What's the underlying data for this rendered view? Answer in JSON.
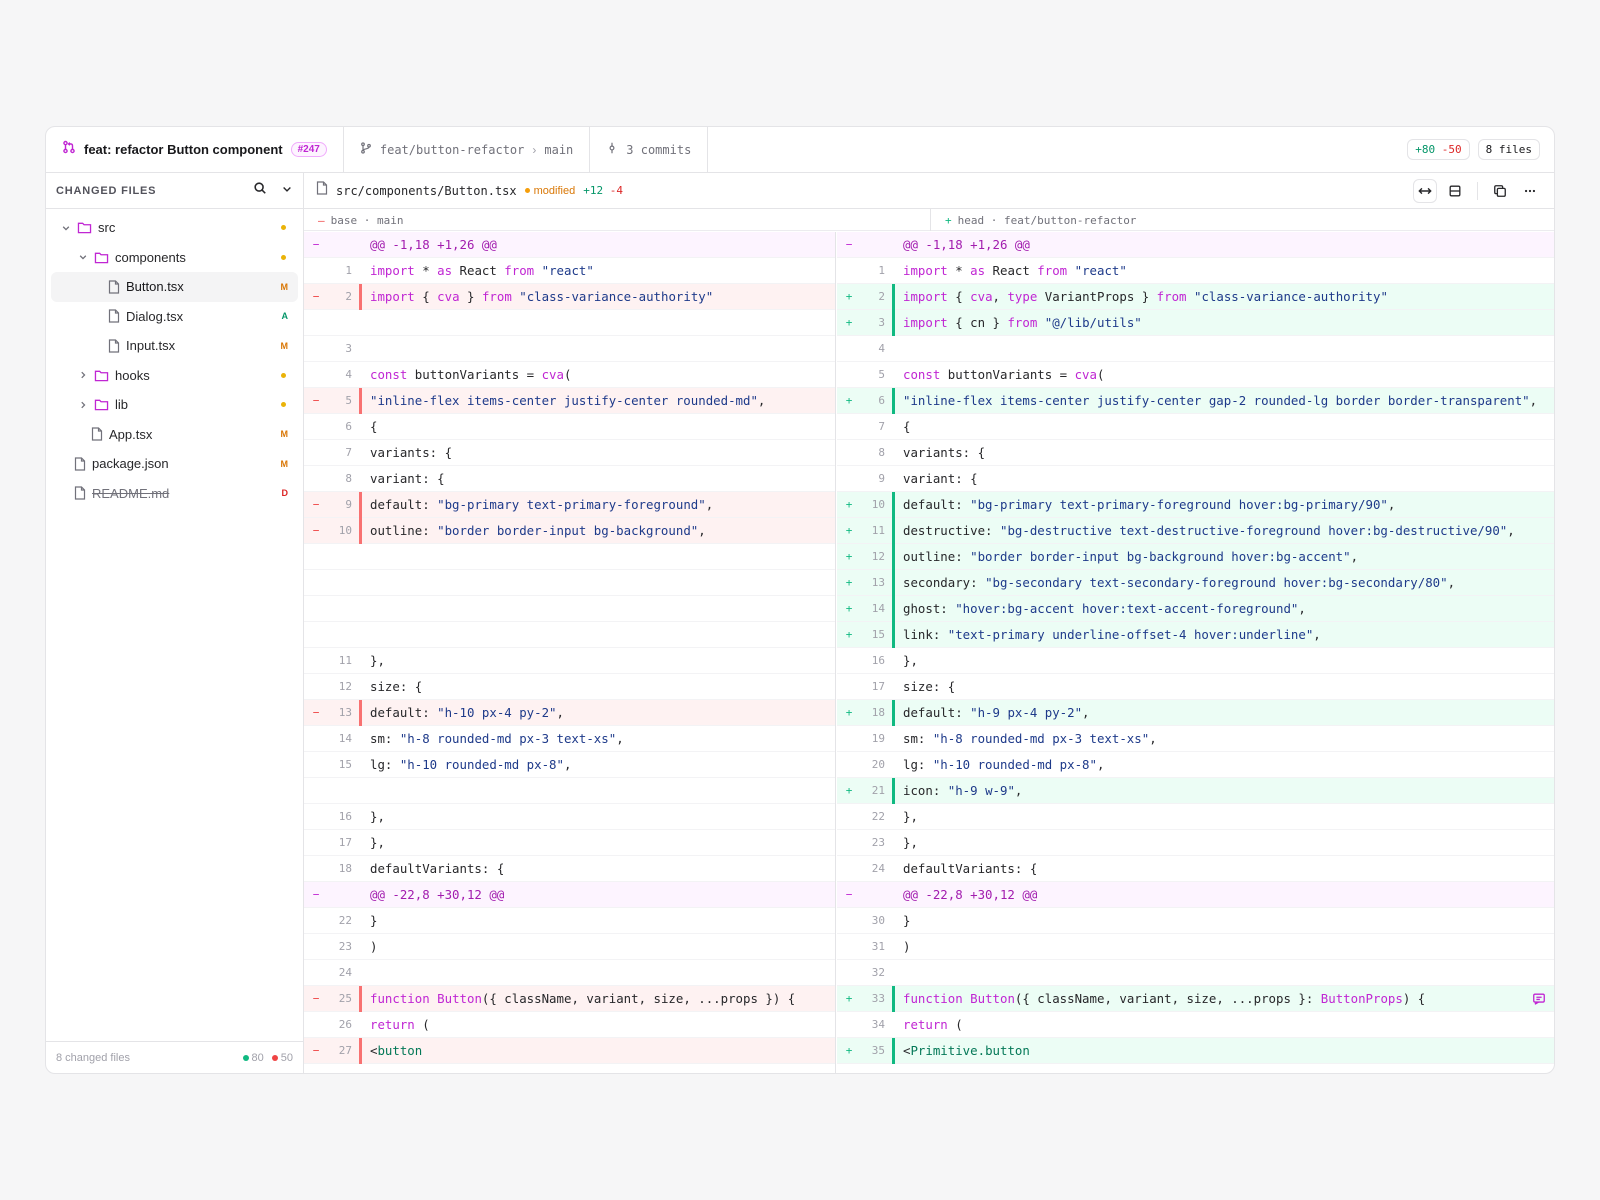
{
  "header": {
    "pr_title": "feat: refactor Button component",
    "pr_number": "#247",
    "source_branch": "feat/button-refactor",
    "target_branch": "main",
    "commits": "3 commits",
    "additions": "+80",
    "deletions": "-50",
    "files": "8 files"
  },
  "sidebar": {
    "title": "CHANGED FILES",
    "footer_label": "8 changed files",
    "footer_additions": "80",
    "footer_deletions": "50",
    "tree": [
      {
        "name": "src",
        "kind": "folder",
        "depth": 0,
        "open": true,
        "badge": "dot"
      },
      {
        "name": "components",
        "kind": "folder",
        "depth": 1,
        "open": true,
        "badge": "dot"
      },
      {
        "name": "Button.tsx",
        "kind": "file",
        "depth": 2,
        "badge": "M",
        "active": true
      },
      {
        "name": "Dialog.tsx",
        "kind": "file",
        "depth": 2,
        "badge": "A"
      },
      {
        "name": "Input.tsx",
        "kind": "file",
        "depth": 2,
        "badge": "M"
      },
      {
        "name": "hooks",
        "kind": "folder",
        "depth": 1,
        "open": false,
        "badge": "dot"
      },
      {
        "name": "lib",
        "kind": "folder",
        "depth": 1,
        "open": false,
        "badge": "dot"
      },
      {
        "name": "App.tsx",
        "kind": "file",
        "depth": 1,
        "badge": "M"
      },
      {
        "name": "package.json",
        "kind": "file",
        "depth": 0,
        "badge": "M"
      },
      {
        "name": "README.md",
        "kind": "file",
        "depth": 0,
        "badge": "D",
        "deleted": true
      }
    ]
  },
  "file": {
    "path": "src/components/Button.tsx",
    "status": "modified",
    "additions": "+12",
    "deletions": "-4"
  },
  "subheader": {
    "left_label": "base · main",
    "right_label": "head · feat/button-refactor"
  },
  "diff": {
    "left": [
      {
        "t": "hunk",
        "n": "",
        "c": "@@ -1,18 +1,26 @@"
      },
      {
        "t": "ctx",
        "n": "1",
        "c": "import * as React from \"react\""
      },
      {
        "t": "del",
        "n": "2",
        "c": "import { cva } from \"class-variance-authority\""
      },
      {
        "t": "empty",
        "n": "",
        "c": ""
      },
      {
        "t": "ctx",
        "n": "3",
        "c": ""
      },
      {
        "t": "ctx",
        "n": "4",
        "c": "const buttonVariants = cva("
      },
      {
        "t": "del",
        "n": "5",
        "c": "\"inline-flex items-center justify-center rounded-md\","
      },
      {
        "t": "ctx",
        "n": "6",
        "c": "{"
      },
      {
        "t": "ctx",
        "n": "7",
        "c": "variants: {"
      },
      {
        "t": "ctx",
        "n": "8",
        "c": "variant: {"
      },
      {
        "t": "del",
        "n": "9",
        "c": "default: \"bg-primary text-primary-foreground\","
      },
      {
        "t": "del",
        "n": "10",
        "c": "outline: \"border border-input bg-background\","
      },
      {
        "t": "empty",
        "n": "",
        "c": ""
      },
      {
        "t": "empty",
        "n": "",
        "c": ""
      },
      {
        "t": "empty",
        "n": "",
        "c": ""
      },
      {
        "t": "empty",
        "n": "",
        "c": ""
      },
      {
        "t": "ctx",
        "n": "11",
        "c": "},"
      },
      {
        "t": "ctx",
        "n": "12",
        "c": "size: {"
      },
      {
        "t": "del",
        "n": "13",
        "c": "default: \"h-10 px-4 py-2\","
      },
      {
        "t": "ctx",
        "n": "14",
        "c": "sm: \"h-8 rounded-md px-3 text-xs\","
      },
      {
        "t": "ctx",
        "n": "15",
        "c": "lg: \"h-10 rounded-md px-8\","
      },
      {
        "t": "empty",
        "n": "",
        "c": ""
      },
      {
        "t": "ctx",
        "n": "16",
        "c": "},"
      },
      {
        "t": "ctx",
        "n": "17",
        "c": "},"
      },
      {
        "t": "ctx",
        "n": "18",
        "c": "defaultVariants: {"
      },
      {
        "t": "hunk",
        "n": "",
        "c": "@@ -22,8 +30,12 @@"
      },
      {
        "t": "ctx",
        "n": "22",
        "c": "}"
      },
      {
        "t": "ctx",
        "n": "23",
        "c": ")"
      },
      {
        "t": "ctx",
        "n": "24",
        "c": ""
      },
      {
        "t": "del",
        "n": "25",
        "c": "function Button({ className, variant, size, ...props }) {"
      },
      {
        "t": "ctx",
        "n": "26",
        "c": "return ("
      },
      {
        "t": "del",
        "n": "27",
        "c": "<button"
      }
    ],
    "right": [
      {
        "t": "hunk",
        "n": "",
        "c": "@@ -1,18 +1,26 @@"
      },
      {
        "t": "ctx",
        "n": "1",
        "c": "import * as React from \"react\""
      },
      {
        "t": "add",
        "n": "2",
        "c": "import { cva, type VariantProps } from \"class-variance-authority\""
      },
      {
        "t": "add",
        "n": "3",
        "c": "import { cn } from \"@/lib/utils\""
      },
      {
        "t": "ctx",
        "n": "4",
        "c": ""
      },
      {
        "t": "ctx",
        "n": "5",
        "c": "const buttonVariants = cva("
      },
      {
        "t": "add",
        "n": "6",
        "c": "\"inline-flex items-center justify-center gap-2 rounded-lg border border-transparent\","
      },
      {
        "t": "ctx",
        "n": "7",
        "c": "{"
      },
      {
        "t": "ctx",
        "n": "8",
        "c": "variants: {"
      },
      {
        "t": "ctx",
        "n": "9",
        "c": "variant: {"
      },
      {
        "t": "add",
        "n": "10",
        "c": "default: \"bg-primary text-primary-foreground hover:bg-primary/90\","
      },
      {
        "t": "add",
        "n": "11",
        "c": "destructive: \"bg-destructive text-destructive-foreground hover:bg-destructive/90\","
      },
      {
        "t": "add",
        "n": "12",
        "c": "outline: \"border border-input bg-background hover:bg-accent\","
      },
      {
        "t": "add",
        "n": "13",
        "c": "secondary: \"bg-secondary text-secondary-foreground hover:bg-secondary/80\","
      },
      {
        "t": "add",
        "n": "14",
        "c": "ghost: \"hover:bg-accent hover:text-accent-foreground\","
      },
      {
        "t": "add",
        "n": "15",
        "c": "link: \"text-primary underline-offset-4 hover:underline\","
      },
      {
        "t": "ctx",
        "n": "16",
        "c": "},"
      },
      {
        "t": "ctx",
        "n": "17",
        "c": "size: {"
      },
      {
        "t": "add",
        "n": "18",
        "c": "default: \"h-9 px-4 py-2\","
      },
      {
        "t": "ctx",
        "n": "19",
        "c": "sm: \"h-8 rounded-md px-3 text-xs\","
      },
      {
        "t": "ctx",
        "n": "20",
        "c": "lg: \"h-10 rounded-md px-8\","
      },
      {
        "t": "add",
        "n": "21",
        "c": "icon: \"h-9 w-9\","
      },
      {
        "t": "ctx",
        "n": "22",
        "c": "},"
      },
      {
        "t": "ctx",
        "n": "23",
        "c": "},"
      },
      {
        "t": "ctx",
        "n": "24",
        "c": "defaultVariants: {"
      },
      {
        "t": "hunk",
        "n": "",
        "c": "@@ -22,8 +30,12 @@"
      },
      {
        "t": "ctx",
        "n": "30",
        "c": "}"
      },
      {
        "t": "ctx",
        "n": "31",
        "c": ")"
      },
      {
        "t": "ctx",
        "n": "32",
        "c": ""
      },
      {
        "t": "add",
        "n": "33",
        "c": "function Button({ className, variant, size, ...props }: ButtonProps) {",
        "comment": true
      },
      {
        "t": "ctx",
        "n": "34",
        "c": "return ("
      },
      {
        "t": "add",
        "n": "35",
        "c": "<Primitive.button"
      }
    ]
  },
  "colors": {
    "keyword": "#c026d3",
    "string": "#1e3a8a",
    "accent": "#c026d3",
    "add": "#10b981",
    "del": "#ef4444"
  }
}
